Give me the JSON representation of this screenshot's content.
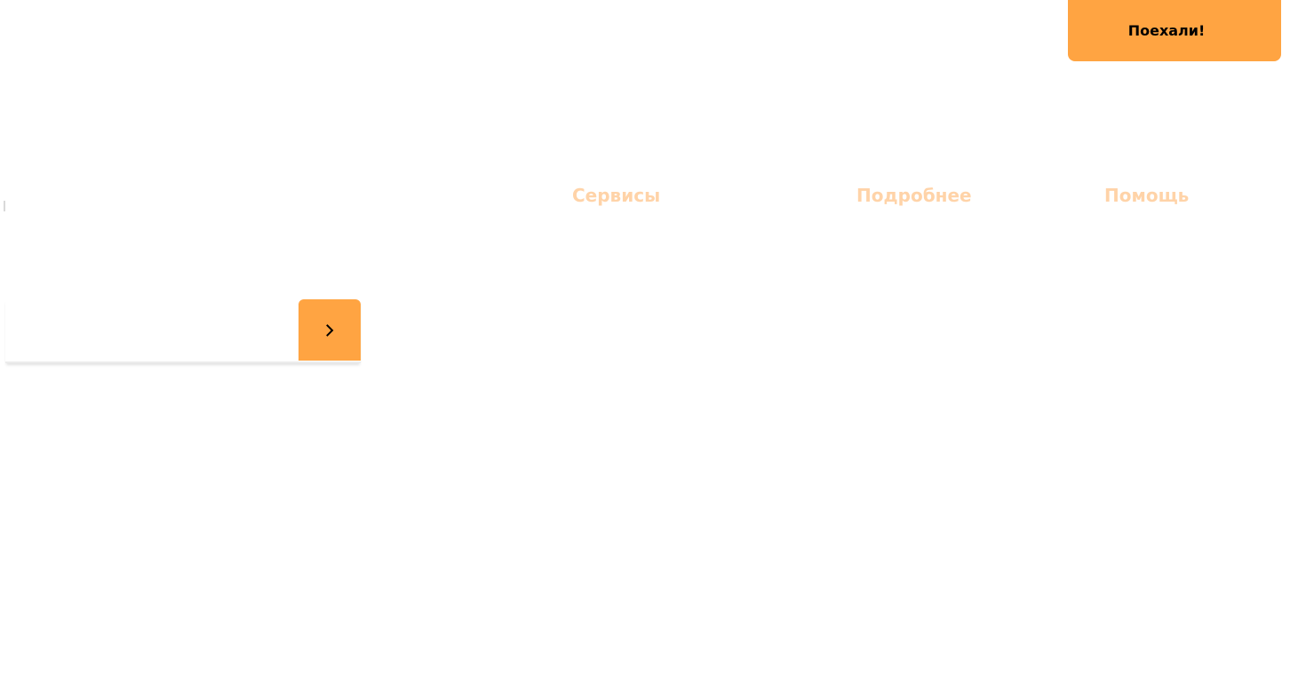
{
  "header": {
    "cta_label": "Поехали!"
  },
  "nav": {
    "items": [
      {
        "label": "Сервисы"
      },
      {
        "label": "Подробнее"
      },
      {
        "label": "Помощь"
      }
    ]
  },
  "search": {
    "value": "",
    "placeholder": "",
    "submit_icon": "chevron-right-icon"
  },
  "colors": {
    "accent": "#ffa442",
    "nav_text": "#ffd3a8",
    "button_text": "#000000",
    "background": "#ffffff"
  }
}
